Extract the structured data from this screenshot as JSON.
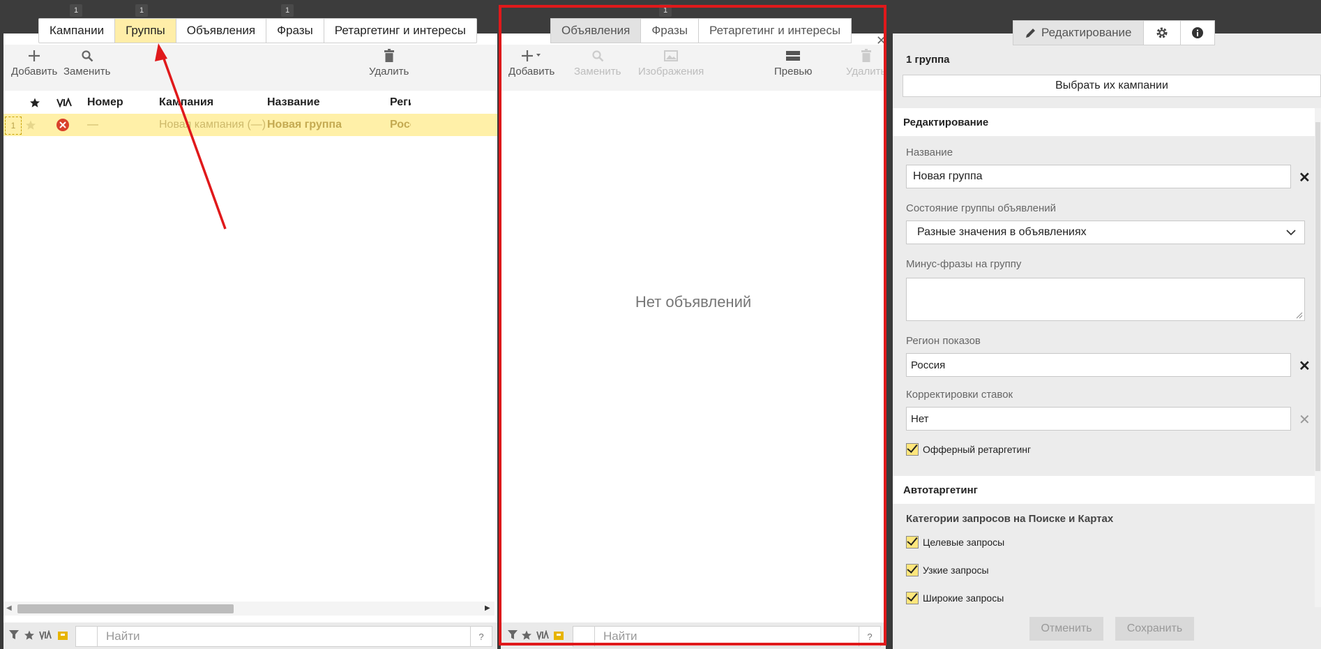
{
  "left": {
    "tabs": [
      {
        "label": "Кампании",
        "badge": "1"
      },
      {
        "label": "Группы",
        "badge": "1"
      },
      {
        "label": "Объявления",
        "badge": null
      },
      {
        "label": "Фразы",
        "badge": "1"
      },
      {
        "label": "Ретаргетинг и интересы",
        "badge": null
      }
    ],
    "toolbar": {
      "add": "Добавить",
      "replace": "Заменить",
      "delete": "Удалить"
    },
    "table": {
      "headers": {
        "number": "Номер",
        "campaign": "Кампания",
        "name": "Название",
        "region": "Регион"
      },
      "row": {
        "index": "1",
        "number": "—",
        "campaign": "Новая кампания (—)",
        "name": "Новая группа",
        "region": "Россия"
      }
    },
    "search_placeholder": "Найти",
    "help": "?"
  },
  "middle": {
    "badge": "1",
    "tabs": [
      "Объявления",
      "Фразы",
      "Ретаргетинг и интересы"
    ],
    "toolbar": {
      "add": "Добавить",
      "replace": "Заменить",
      "images": "Изображения",
      "preview": "Превью",
      "delete": "Удалить"
    },
    "empty_text": "Нет объявлений",
    "search_placeholder": "Найти",
    "help": "?"
  },
  "right": {
    "tabs": {
      "edit": "Редактирование"
    },
    "group_count": "1 группа",
    "select_campaign": "Выбрать их кампании",
    "section_edit": "Редактирование",
    "name_label": "Название",
    "name_value": "Новая группа",
    "state_label": "Состояние группы объявлений",
    "state_value": "Разные значения в объявлениях",
    "minus_label": "Минус-фразы на группу",
    "region_label": "Регион показов",
    "region_value": "Россия",
    "bid_label": "Корректировки ставок",
    "bid_value": "Нет",
    "offer_retargeting": "Офферный ретаргетинг",
    "section_auto": "Автотаргетинг",
    "categories_label": "Категории запросов на Поиске и Картах",
    "cat1": "Целевые запросы",
    "cat2": "Узкие запросы",
    "cat3": "Широкие запросы",
    "cancel": "Отменить",
    "save": "Сохранить"
  },
  "colors": {
    "highlight": "#ffeea8",
    "outline": "#e0191b",
    "arrow": "#e0191b"
  }
}
